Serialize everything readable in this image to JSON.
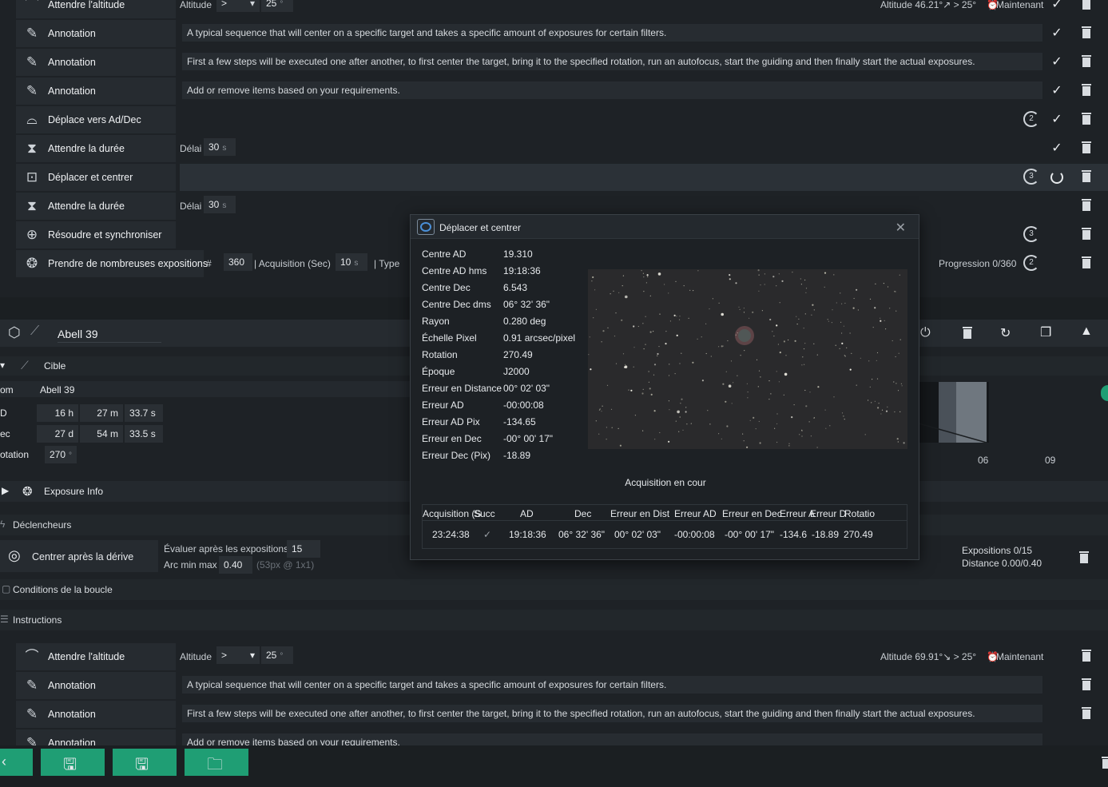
{
  "top_rows": [
    {
      "name": "Attendre l'altitude",
      "label_altitude": "Altitude",
      "op": ">",
      "value": "25",
      "unit": "°",
      "status": "Altitude 46.21°↗ > 25°",
      "when": "Maintenant"
    },
    {
      "name": "Annotation",
      "text": "A typical sequence that will center on a specific target and takes a specific amount of exposures for certain filters."
    },
    {
      "name": "Annotation",
      "text": "First a few steps will be executed one after another, to first center the target, bring it to the specified rotation, run an autofocus, start the guiding and then finally start the actual exposures."
    },
    {
      "name": "Annotation",
      "text": "Add or remove items based on your requirements."
    },
    {
      "name": "Déplace vers Ad/Dec",
      "rot": "2"
    },
    {
      "name": "Attendre la durée",
      "label_delay": "Délai",
      "value": "30",
      "unit": "s"
    },
    {
      "name": "Déplacer et centrer",
      "rot": "3"
    },
    {
      "name": "Attendre la durée",
      "label_delay": "Délai",
      "value": "30",
      "unit": "s"
    },
    {
      "name": "Résoudre et synchroniser",
      "rot": "3"
    },
    {
      "name": "Prendre de nombreuses expositions",
      "hash": "#",
      "count": "360",
      "acq_label": "| Acquisition (Sec)",
      "acq_value": "10",
      "acq_unit": "s",
      "type_label": "| Type",
      "progress": "Progression 0/360",
      "rot": "2"
    }
  ],
  "target_panel": {
    "title": "Abell 39",
    "section": "Cible",
    "fields": [
      {
        "label": "om",
        "value": "Abell 39"
      },
      {
        "label": "D",
        "h": "16",
        "hu": "h",
        "m": "27",
        "mu": "m",
        "s": "33.7",
        "su": "s"
      },
      {
        "label": "ec",
        "h": "27",
        "hu": "d",
        "m": "54",
        "mu": "m",
        "s": "33.5",
        "su": "s"
      },
      {
        "label": "otation",
        "value": "270",
        "unit": "°"
      }
    ],
    "exposure_info": "Exposure Info",
    "triggers": "Déclencheurs",
    "center_after_drift": "Centrer après la dérive",
    "evaluate_label": "Évaluer après les expositions",
    "evaluate_value": "15",
    "arc_label": "Arc min max",
    "arc_value": "0.40",
    "arc_hint": "(53px @ 1x1)",
    "expositions": "Expositions 0/15",
    "distance": "Distance 0.00/0.40",
    "loop_conditions": "Conditions de la boucle",
    "instructions": "Instructions",
    "chart_ticks": [
      "06",
      "09"
    ]
  },
  "bottom_rows": [
    {
      "name": "Attendre l'altitude",
      "label_altitude": "Altitude",
      "op": ">",
      "value": "25",
      "unit": "°",
      "status": "Altitude 69.91°↘ > 25°",
      "when": "Maintenant"
    },
    {
      "name": "Annotation",
      "text": "A typical sequence that will center on a specific target and takes a specific amount of exposures for certain filters."
    },
    {
      "name": "Annotation",
      "text": "First a few steps will be executed one after another, to first center the target, bring it to the specified rotation, run an autofocus, start the guiding and then finally start the actual exposures."
    },
    {
      "name": "Annotation",
      "text": "Add or remove items based on your requirements."
    }
  ],
  "modal": {
    "title": "Déplacer et centrer",
    "close": "✕",
    "props": [
      {
        "k": "Centre AD",
        "v": "19.310"
      },
      {
        "k": "Centre AD hms",
        "v": "19:18:36"
      },
      {
        "k": "Centre Dec",
        "v": "6.543"
      },
      {
        "k": "Centre Dec dms",
        "v": "06° 32' 36\""
      },
      {
        "k": "Rayon",
        "v": "0.280 deg"
      },
      {
        "k": "Échelle Pixel",
        "v": "0.91 arcsec/pixel"
      },
      {
        "k": "Rotation",
        "v": "270.49"
      },
      {
        "k": "Époque",
        "v": "J2000"
      },
      {
        "k": "Erreur en Distance",
        "v": "00° 02' 03\""
      },
      {
        "k": "Erreur AD",
        "v": "-00:00:08"
      },
      {
        "k": "Erreur AD Pix",
        "v": "-134.65"
      },
      {
        "k": "Erreur en Dec",
        "v": "-00° 00' 17\""
      },
      {
        "k": "Erreur Dec (Pix)",
        "v": "-18.89"
      }
    ],
    "status": "Acquisition en cour",
    "table_headers": [
      "Acquisition (S",
      "Succ",
      "AD",
      "Dec",
      "Erreur en Dist",
      "Erreur AD",
      "Erreur en Dec",
      "Erreur A",
      "Erreur D",
      "Rotatio"
    ],
    "table_row": [
      "23:24:38",
      "✓",
      "19:18:36",
      "06° 32' 36\"",
      "00° 02' 03\"",
      "-00:00:08",
      "-00° 00' 17\"",
      "-134.6",
      "-18.89",
      "270.49"
    ]
  },
  "colors": {
    "accent": "#1f9e74",
    "bg": "#1e2226"
  }
}
